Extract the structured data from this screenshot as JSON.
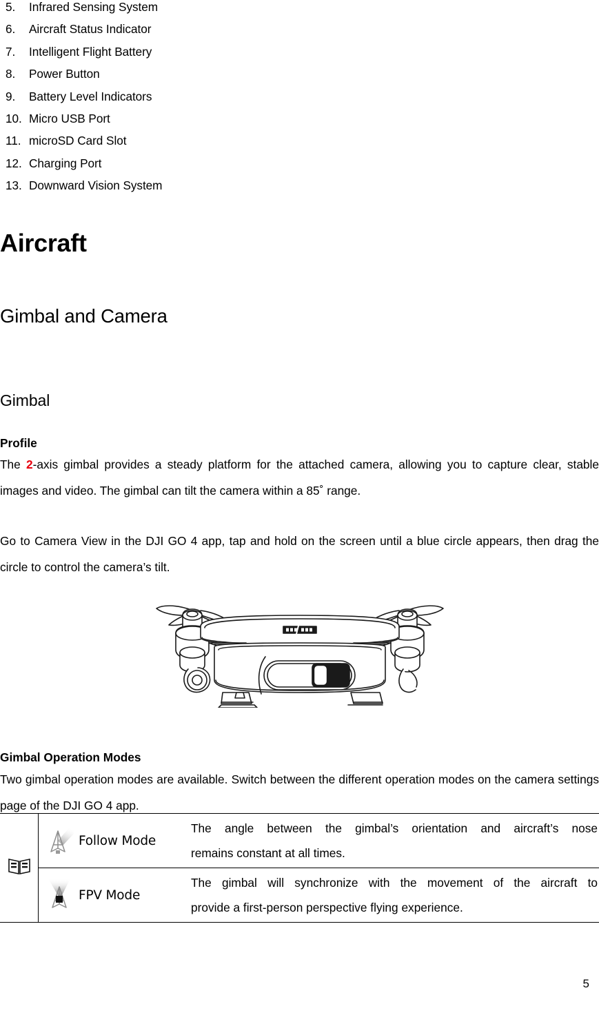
{
  "document": {
    "page_number": "5",
    "accent_red": "#E8000D"
  },
  "parts_list": [
    {
      "index": "5.",
      "label": "Infrared Sensing System"
    },
    {
      "index": "6.",
      "label": "Aircraft Status Indicator"
    },
    {
      "index": "7.",
      "label": "Intelligent Flight Battery"
    },
    {
      "index": "8.",
      "label": "Power Button"
    },
    {
      "index": "9.",
      "label": "Battery Level Indicators"
    },
    {
      "index": "10.",
      "label": "Micro USB Port"
    },
    {
      "index": "11.",
      "label": "microSD Card Slot"
    },
    {
      "index": "12.",
      "label": "Charging Port"
    },
    {
      "index": "13.",
      "label": "Downward Vision System"
    }
  ],
  "headings": {
    "h1": "Aircraft",
    "h2": "Gimbal and Camera",
    "h3": "Gimbal"
  },
  "profile": {
    "label": "Profile",
    "sentence_lead": "The ",
    "sentence_red": "2",
    "sentence_rest": "-axis gimbal provides a steady platform for the attached camera, allowing you to capture clear, stable images and video. The gimbal can tilt the camera within a 85˚ range."
  },
  "camera_view": {
    "paragraph": "Go to Camera View in the DJI GO 4 app, tap and hold on the screen until a blue circle appears, then drag the circle to control the camera’s tilt."
  },
  "illustration": {
    "name": "aircraft-front-view-line-drawing"
  },
  "gimbal_modes": {
    "label": "Gimbal Operation Modes",
    "paragraph": "Two gimbal operation modes are available. Switch between the different operation modes on the camera settings page of the DJI GO 4 app.",
    "note_icon": "book-icon",
    "rows": [
      {
        "icon": "drone-follow-mode-icon",
        "mode": "Follow Mode",
        "desc_line_1": "The angle between the gimbal’s orientation and aircraft’s nose",
        "desc_line_2": "remains constant at all times."
      },
      {
        "icon": "drone-fpv-mode-icon",
        "mode": "FPV Mode",
        "desc_line_1": "The gimbal will synchronize with the movement of the aircraft to",
        "desc_line_2": "provide a first-person perspective flying experience."
      }
    ]
  }
}
